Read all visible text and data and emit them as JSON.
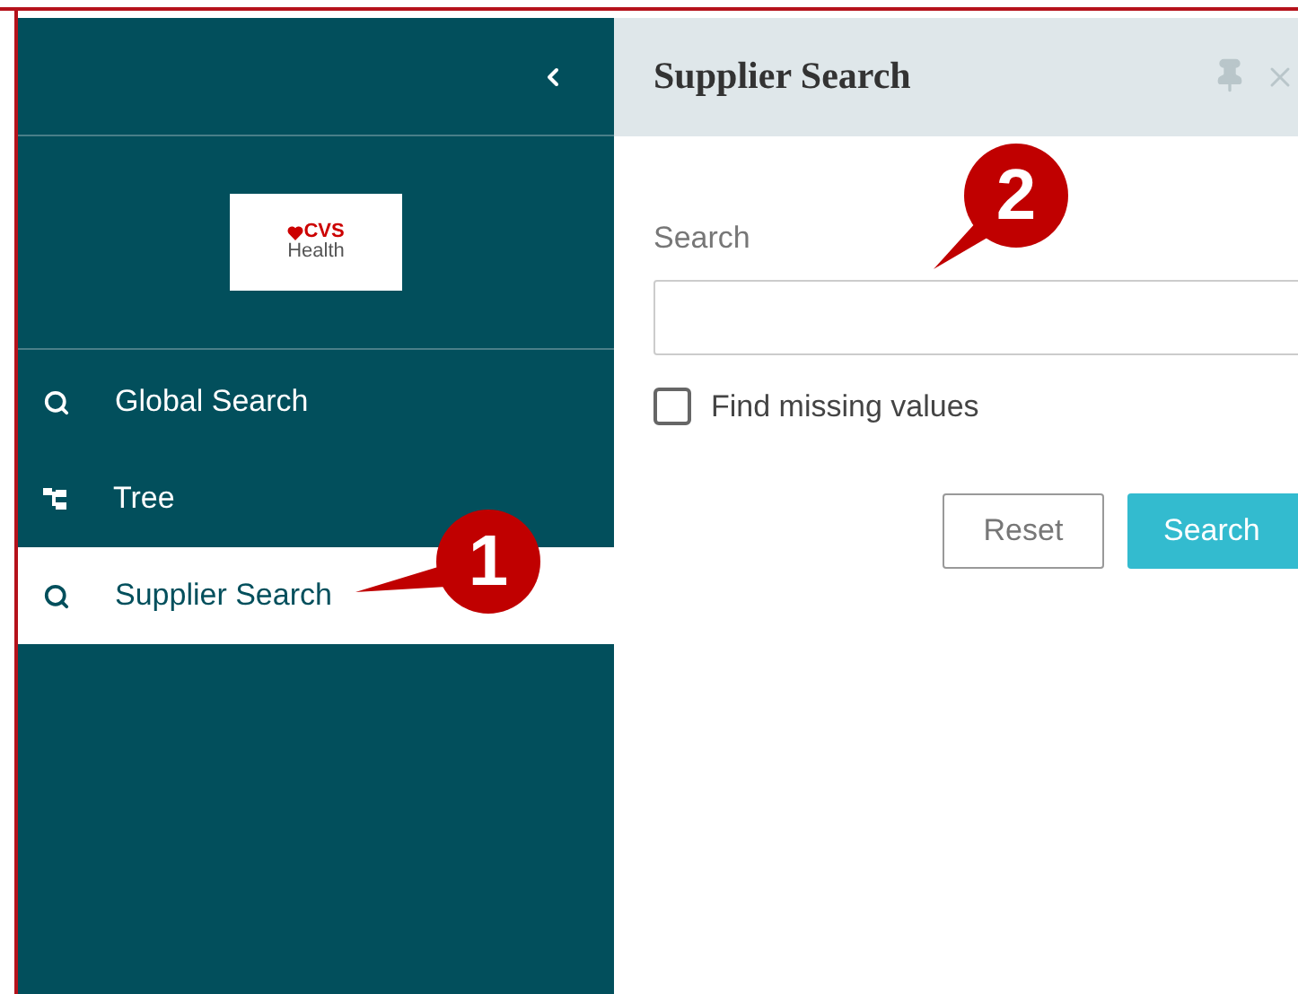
{
  "sidebar": {
    "logo": {
      "brand": "CVS",
      "subtitle": "Health"
    },
    "items": [
      {
        "label": "Global Search",
        "kind": "search",
        "selected": false
      },
      {
        "label": "Tree",
        "kind": "tree",
        "selected": false
      },
      {
        "label": "Supplier Search",
        "kind": "search",
        "selected": true
      }
    ]
  },
  "panel": {
    "title": "Supplier Search",
    "search_label": "Search",
    "find_missing": {
      "label": "Find missing values",
      "checked": false
    },
    "buttons": [
      {
        "label": "Reset",
        "kind": "secondary"
      },
      {
        "label": "Search",
        "kind": "primary"
      }
    ]
  },
  "callouts": [
    {
      "number": "1"
    },
    {
      "number": "2"
    }
  ]
}
